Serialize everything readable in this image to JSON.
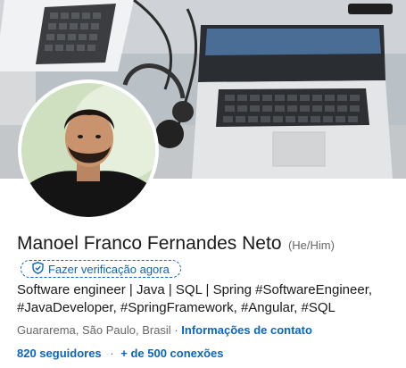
{
  "profile": {
    "name": "Manoel Franco Fernandes Neto",
    "pronouns": "(He/Him)",
    "verify_label": "Fazer verificação agora",
    "headline": "Software engineer | Java | SQL | Spring #SoftwareEngineer, #JavaDeveloper, #SpringFramework, #Angular, #SQL",
    "location": "Guararema, São Paulo, Brasil",
    "location_separator": "·",
    "contact_label": "Informações de contato",
    "followers_label": "820 seguidores",
    "stats_separator": "·",
    "connections_label": "+ de 500 conexões"
  },
  "icons": {
    "verify": "shield-check-icon"
  },
  "colors": {
    "link_blue": "#0a66c2",
    "text_primary": "#191919",
    "text_secondary": "#666666"
  }
}
